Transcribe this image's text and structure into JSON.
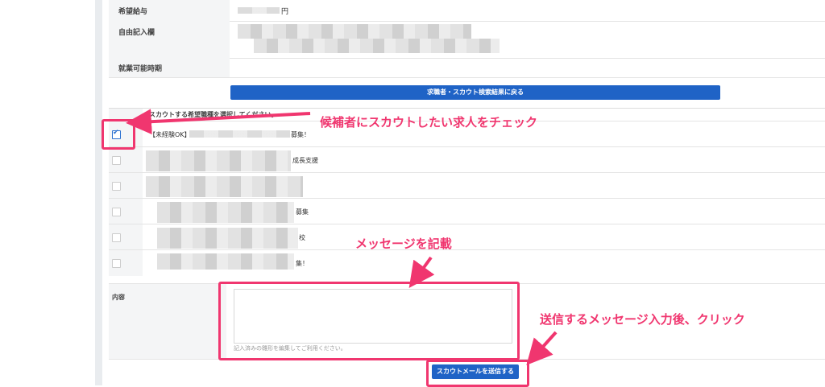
{
  "profile": {
    "salary_label": "希望給与",
    "salary_suffix": "円",
    "free_label": "自由記入欄",
    "start_label": "就業可能時期"
  },
  "back_button": "求職者・スカウト検索結果に戻る",
  "jobs": {
    "header": "スカウトする希望職種を選択してください。",
    "rows": [
      {
        "prefix": "【未経験OK】",
        "suffix": "募集！",
        "checked": true
      },
      {
        "prefix": "",
        "suffix": "成長支援",
        "checked": false
      },
      {
        "prefix": "",
        "suffix": "",
        "checked": false
      },
      {
        "prefix": "",
        "suffix": "募集",
        "checked": false
      },
      {
        "prefix": "",
        "suffix": "校",
        "checked": false
      },
      {
        "prefix": "",
        "suffix": "集！",
        "checked": false
      }
    ]
  },
  "content": {
    "label": "内容",
    "hint": "記入済みの雛形を編集してご利用ください。"
  },
  "send_button": "スカウトメールを送信する",
  "annotations": {
    "check": "候補者にスカウトしたい求人をチェック",
    "message": "メッセージを記載",
    "send": "送信するメッセージ入力後、クリック"
  },
  "colors": {
    "accent": "#1f63c6",
    "annotation": "#f0366f"
  }
}
